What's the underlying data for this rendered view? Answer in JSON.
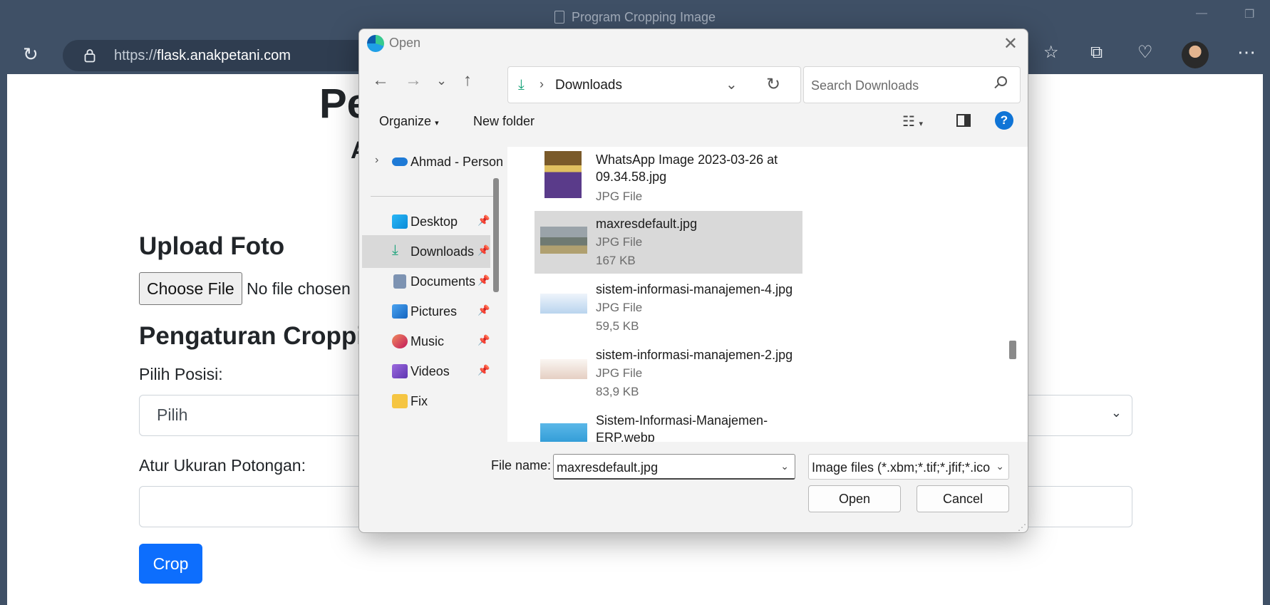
{
  "window": {
    "title": "Program Cropping Image",
    "minimize_icon": "minimize-icon",
    "restore_icon": "restore-icon"
  },
  "browser": {
    "url_scheme": "https://",
    "url_host": "flask.anakpetani.com",
    "icons": [
      "refresh-icon",
      "lock-icon",
      "favorites-icon",
      "collections-icon",
      "browser-essentials-icon",
      "profile-avatar",
      "more-menu-icon"
    ]
  },
  "page": {
    "title_partial": "Pe",
    "subtitle_partial": "A",
    "upload_heading": "Upload Foto",
    "choose_file_label": "Choose File",
    "no_file_text": "No file chosen",
    "crop_heading_partial": "Pengaturan Croppi",
    "position_label": "Pilih Posisi:",
    "position_value": "Pilih",
    "size_label": "Atur Ukuran Potongan:",
    "size_value": "",
    "crop_button": "Crop",
    "colors": {
      "primary": "#0d6efd"
    }
  },
  "dialog": {
    "title": "Open",
    "path_current": "Downloads",
    "search_placeholder": "Search Downloads",
    "organize_label": "Organize",
    "new_folder_label": "New folder",
    "help_label": "?",
    "nav_items": [
      {
        "label": "Ahmad - Person",
        "icon": "onedrive-icon",
        "pinned": false
      },
      {
        "label": "Desktop",
        "icon": "desktop-folder-icon",
        "pinned": true
      },
      {
        "label": "Downloads",
        "icon": "downloads-folder-icon",
        "pinned": true,
        "selected": true
      },
      {
        "label": "Documents",
        "icon": "documents-folder-icon",
        "pinned": true
      },
      {
        "label": "Pictures",
        "icon": "pictures-folder-icon",
        "pinned": true
      },
      {
        "label": "Music",
        "icon": "music-folder-icon",
        "pinned": true
      },
      {
        "label": "Videos",
        "icon": "videos-folder-icon",
        "pinned": true
      },
      {
        "label": "Fix",
        "icon": "folder-icon",
        "pinned": false
      }
    ],
    "files": [
      {
        "name": "WhatsApp Image 2023-03-26 at 09.34.58.jpg",
        "type": "JPG File",
        "size": ""
      },
      {
        "name": "maxresdefault.jpg",
        "type": "JPG File",
        "size": "167 KB",
        "selected": true
      },
      {
        "name": "sistem-informasi-manajemen-4.jpg",
        "type": "JPG File",
        "size": "59,5 KB"
      },
      {
        "name": "sistem-informasi-manajemen-2.jpg",
        "type": "JPG File",
        "size": "83,9 KB"
      },
      {
        "name": "Sistem-Informasi-Manajemen-ERP.webp",
        "type": "",
        "size": ""
      }
    ],
    "file_name_label": "File name:",
    "file_name_value": "maxresdefault.jpg",
    "file_type_value": "Image files (*.xbm;*.tif;*.jfif;*.ico",
    "open_button": "Open",
    "cancel_button": "Cancel"
  }
}
